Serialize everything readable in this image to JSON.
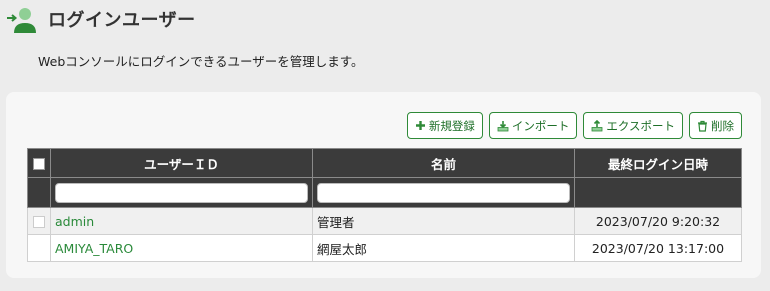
{
  "page": {
    "title": "ログインユーザー",
    "description": "Webコンソールにログインできるユーザーを管理します。"
  },
  "toolbar": {
    "new_label": "新規登録",
    "import_label": "インポート",
    "export_label": "エクスポート",
    "delete_label": "削除"
  },
  "table": {
    "columns": {
      "user_id": "ユーザーＩＤ",
      "name": "名前",
      "last_login": "最終ログイン日時"
    },
    "rows": [
      {
        "user_id": "admin",
        "name": "管理者",
        "last_login": "2023/07/20 9:20:32"
      },
      {
        "user_id": "AMIYA_TARO",
        "name": "網屋太郎",
        "last_login": "2023/07/20 13:17:00"
      }
    ]
  },
  "colors": {
    "accent": "#2f8a38",
    "header_bg": "#3b3b3b"
  }
}
